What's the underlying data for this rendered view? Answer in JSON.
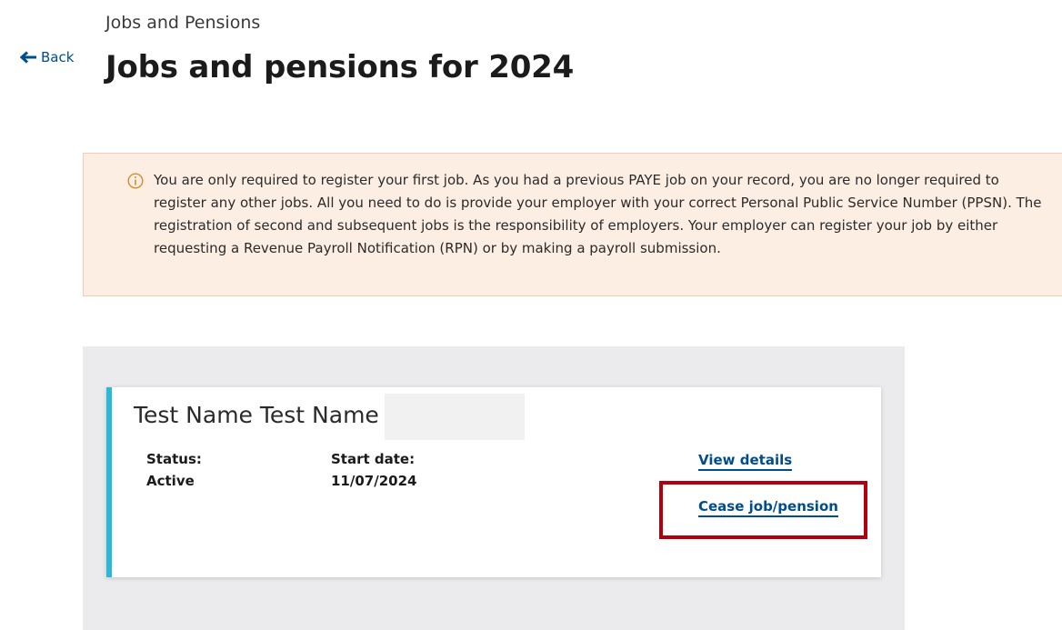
{
  "header": {
    "caption": "Jobs and Pensions",
    "back_label": "Back",
    "title": "Jobs and pensions for 2024"
  },
  "notice": {
    "icon": "info-icon",
    "text": "You are only required to register your first job. As you had a previous PAYE job on your record, you are no longer required to register any other jobs. All you need to do is provide your employer with your correct Personal Public Service Number (PPSN). The registration of second and subsequent jobs is the responsibility of employers. Your employer can register your job by either requesting a Revenue Payroll Notification (RPN) or by making a payroll submission."
  },
  "job": {
    "name": "Test Name Test Name",
    "status_label": "Status:",
    "status_value": "Active",
    "start_label": "Start date:",
    "start_value": "11/07/2024",
    "view_details_label": "View details",
    "cease_label": "Cease job/pension"
  },
  "colors": {
    "link": "#004d8c",
    "card_accent": "#2cb8d8",
    "banner_background": "#fdeee4",
    "banner_border": "#f7ccb0",
    "highlight": "#b3000f",
    "panel_background": "#ebebed"
  }
}
